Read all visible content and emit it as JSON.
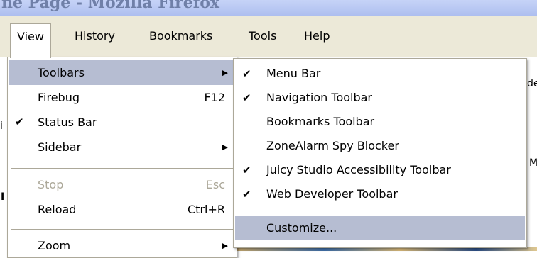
{
  "window": {
    "title": "ne Page - Mozilla Firefox"
  },
  "menubar": {
    "items": [
      {
        "label": "View"
      },
      {
        "label": "History"
      },
      {
        "label": "Bookmarks"
      },
      {
        "label": "Tools"
      },
      {
        "label": "Help"
      }
    ]
  },
  "background_fragments": {
    "right_top": "de",
    "right_mid": "M",
    "left_a": "i",
    "left_b": "I"
  },
  "view_menu": {
    "items": [
      {
        "label": "Toolbars",
        "shortcut": "",
        "submenu": true,
        "checked": false,
        "highlighted": true,
        "disabled": false
      },
      {
        "label": "Firebug",
        "shortcut": "F12",
        "submenu": false,
        "checked": false,
        "highlighted": false,
        "disabled": false
      },
      {
        "label": "Status Bar",
        "shortcut": "",
        "submenu": false,
        "checked": true,
        "highlighted": false,
        "disabled": false
      },
      {
        "label": "Sidebar",
        "shortcut": "",
        "submenu": true,
        "checked": false,
        "highlighted": false,
        "disabled": false
      },
      {
        "label": "Stop",
        "shortcut": "Esc",
        "submenu": false,
        "checked": false,
        "highlighted": false,
        "disabled": true
      },
      {
        "label": "Reload",
        "shortcut": "Ctrl+R",
        "submenu": false,
        "checked": false,
        "highlighted": false,
        "disabled": false
      },
      {
        "label": "Zoom",
        "shortcut": "",
        "submenu": true,
        "checked": false,
        "highlighted": false,
        "disabled": false
      }
    ],
    "check_glyph": "✔",
    "arrow_glyph": "▶"
  },
  "toolbars_submenu": {
    "items": [
      {
        "label": "Menu Bar",
        "checked": true
      },
      {
        "label": "Navigation Toolbar",
        "checked": true
      },
      {
        "label": "Bookmarks Toolbar",
        "checked": false
      },
      {
        "label": "ZoneAlarm Spy Blocker",
        "checked": false
      },
      {
        "label": "Juicy Studio Accessibility Toolbar",
        "checked": true
      },
      {
        "label": "Web Developer Toolbar",
        "checked": true
      }
    ],
    "customize": {
      "label": "Customize...",
      "highlighted": true
    }
  },
  "colors": {
    "menu_bg": "#ece9d8",
    "highlight": "#b6bdd2",
    "disabled_text": "#aca899",
    "border": "#aca899"
  }
}
